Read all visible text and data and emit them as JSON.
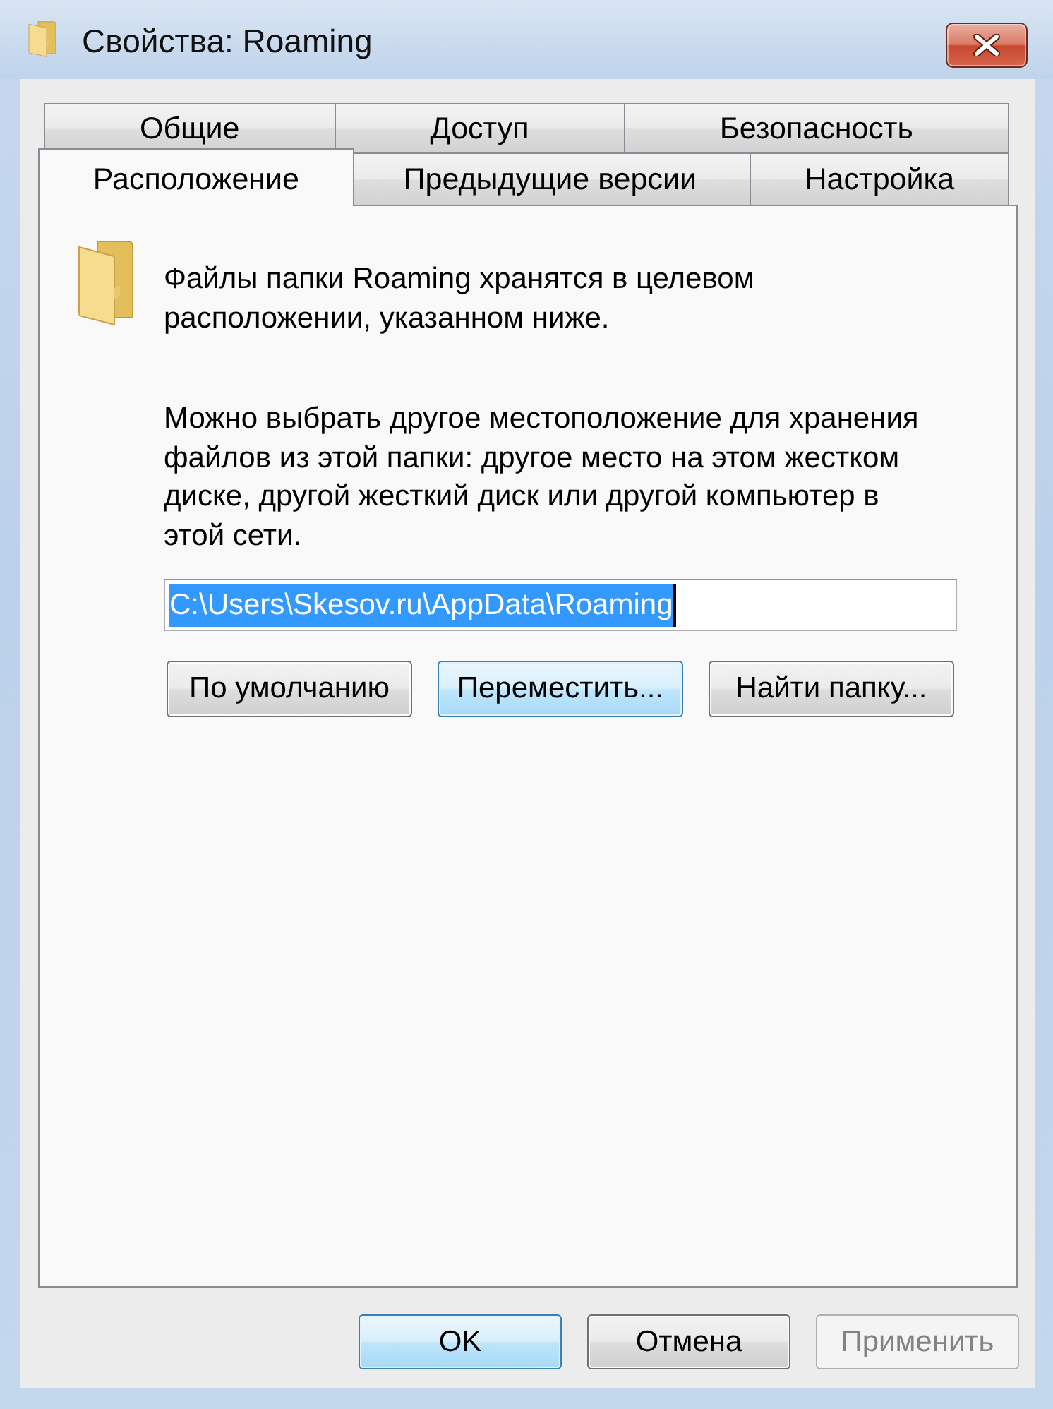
{
  "window": {
    "title": "Свойства: Roaming"
  },
  "tab_rows": [
    {
      "tabs": [
        {
          "label": "Общие",
          "selected": false
        },
        {
          "label": "Доступ",
          "selected": false
        },
        {
          "label": "Безопасность",
          "selected": false
        }
      ]
    },
    {
      "tabs": [
        {
          "label": "Расположение",
          "selected": true
        },
        {
          "label": "Предыдущие версии",
          "selected": false
        },
        {
          "label": "Настройка",
          "selected": false
        }
      ]
    }
  ],
  "location": {
    "intro": "Файлы папки Roaming хранятся в целевом расположении, указанном ниже.",
    "hint": "Можно выбрать другое местоположение для хранения файлов из этой папки: другое место на этом жестком диске, другой жесткий диск или другой компьютер в этой сети.",
    "path_field": {
      "value": "C:\\Users\\Skesov.ru\\AppData\\Roaming",
      "selected": true
    },
    "buttons": [
      {
        "label": "По умолчанию",
        "highlighted": false
      },
      {
        "label": "Переместить...",
        "highlighted": true
      },
      {
        "label": "Найти папку...",
        "highlighted": false
      }
    ]
  },
  "footer_buttons": [
    {
      "label": "OK",
      "highlighted": true,
      "disabled": false
    },
    {
      "label": "Отмена",
      "highlighted": false,
      "disabled": false
    },
    {
      "label": "Применить",
      "highlighted": false,
      "disabled": true
    }
  ]
}
